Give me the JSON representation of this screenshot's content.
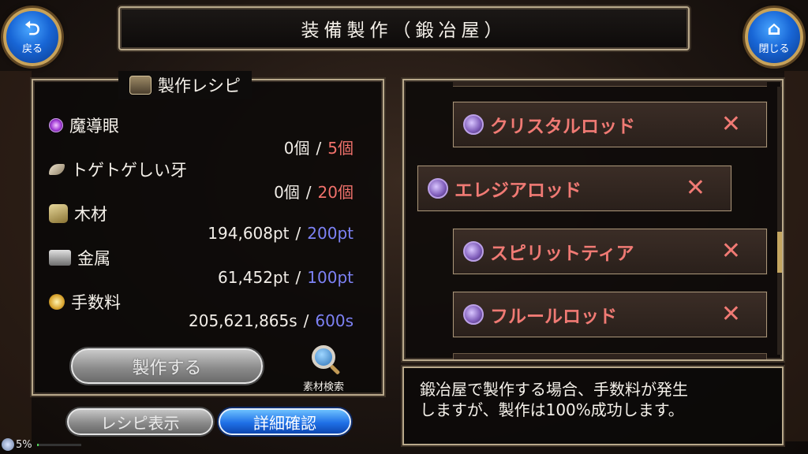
{
  "header": {
    "title": "装備製作（鍛冶屋）",
    "back_label": "戻る",
    "close_label": "閉じる"
  },
  "recipe_panel": {
    "title": "製作レシピ",
    "materials": [
      {
        "name": "魔導眼",
        "have": "0個",
        "need": "5個",
        "need_color": "#f0716b",
        "icon": "purple-eye-icon"
      },
      {
        "name": "トゲトゲしい牙",
        "have": "0個",
        "need": "20個",
        "need_color": "#f0716b",
        "icon": "fang-icon"
      },
      {
        "name": "木材",
        "have": "194,608pt",
        "need": "200pt",
        "need_color": "#7d82f5",
        "icon": "wood-icon"
      },
      {
        "name": "金属",
        "have": "61,452pt",
        "need": "100pt",
        "need_color": "#7d82f5",
        "icon": "metal-ingot-icon"
      },
      {
        "name": "手数料",
        "have": "205,621,865s",
        "need": "600s",
        "need_color": "#7d82f5",
        "icon": "coin-icon"
      }
    ],
    "separator": "/",
    "make_button": "製作する",
    "search_label": "素材検索",
    "recipe_display_button": "レシピ表示",
    "detail_button": "詳細確認"
  },
  "recipe_list": [
    {
      "name": "クリスタルロッド",
      "mark": "✕"
    },
    {
      "name": "エレジアロッド",
      "mark": "✕"
    },
    {
      "name": "スピリットティア",
      "mark": "✕"
    },
    {
      "name": "フルールロッド",
      "mark": "✕"
    }
  ],
  "message": {
    "line1": "鍛冶屋で製作する場合、手数料が発生",
    "line2": "しますが、製作は100%成功します。"
  },
  "status": {
    "battery": "5%",
    "battery_level": 0.05
  },
  "colors": {
    "accent_blue": "#1866d6",
    "frame_gold": "#b9a98b",
    "warning_red": "#f07a74"
  }
}
